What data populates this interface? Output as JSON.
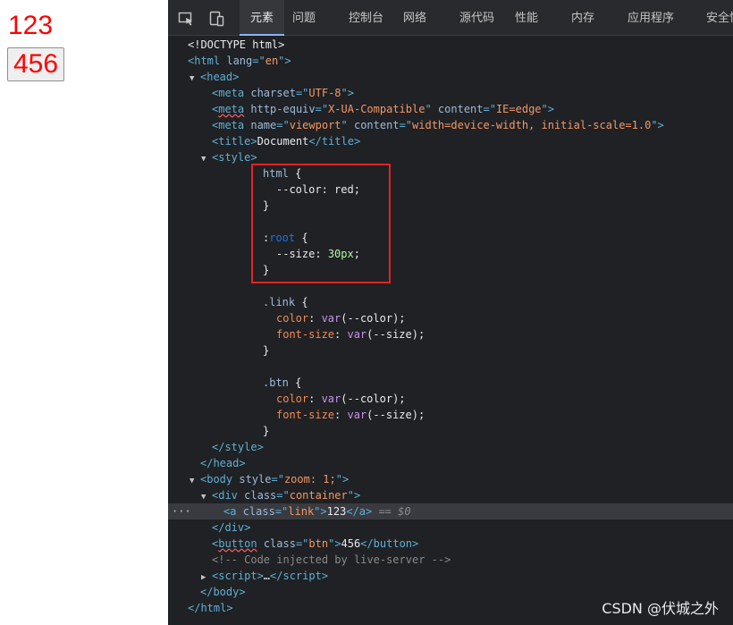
{
  "preview": {
    "link_text": "123",
    "button_text": "456"
  },
  "toolbar": {
    "tabs": [
      {
        "label": "元素",
        "active": true
      },
      {
        "label": "问题"
      },
      {
        "label": "控制台"
      },
      {
        "label": "网络"
      },
      {
        "label": "源代码"
      },
      {
        "label": "性能"
      },
      {
        "label": "内存"
      },
      {
        "label": "应用程序"
      },
      {
        "label": "安全性"
      }
    ]
  },
  "dom": {
    "doctype": "<!DOCTYPE html>",
    "html_lang": "en",
    "meta_charset": "UTF-8",
    "meta_http_equiv": "X-UA-Compatible",
    "meta_http_content": "IE=edge",
    "meta_name": "viewport",
    "meta_name_content": "width=device-width, initial-scale=1.0",
    "title": "Document",
    "css": {
      "html_selector": "html",
      "color_prop": "--color",
      "color_val": "red",
      "root_selector": ":root",
      "size_prop": "--size",
      "size_val": "30px",
      "link_selector": ".link",
      "btn_selector": ".btn",
      "color": "color",
      "font_size": "font-size",
      "var_color": "--color",
      "var_size": "--size"
    },
    "body_style": "zoom: 1;",
    "div_class": "container",
    "a_class": "link",
    "a_text": "123",
    "selected_marker": "== $0",
    "button_class": "btn",
    "button_text": "456",
    "comment": "<!-- Code injected by live-server -->",
    "script_ellipsis": "…"
  },
  "watermark": "CSDN @伏城之外",
  "colors": {
    "highlight_box": "#e02424",
    "preview_text": "#ff0000",
    "active_tab_underline": "#8ab4f8"
  }
}
